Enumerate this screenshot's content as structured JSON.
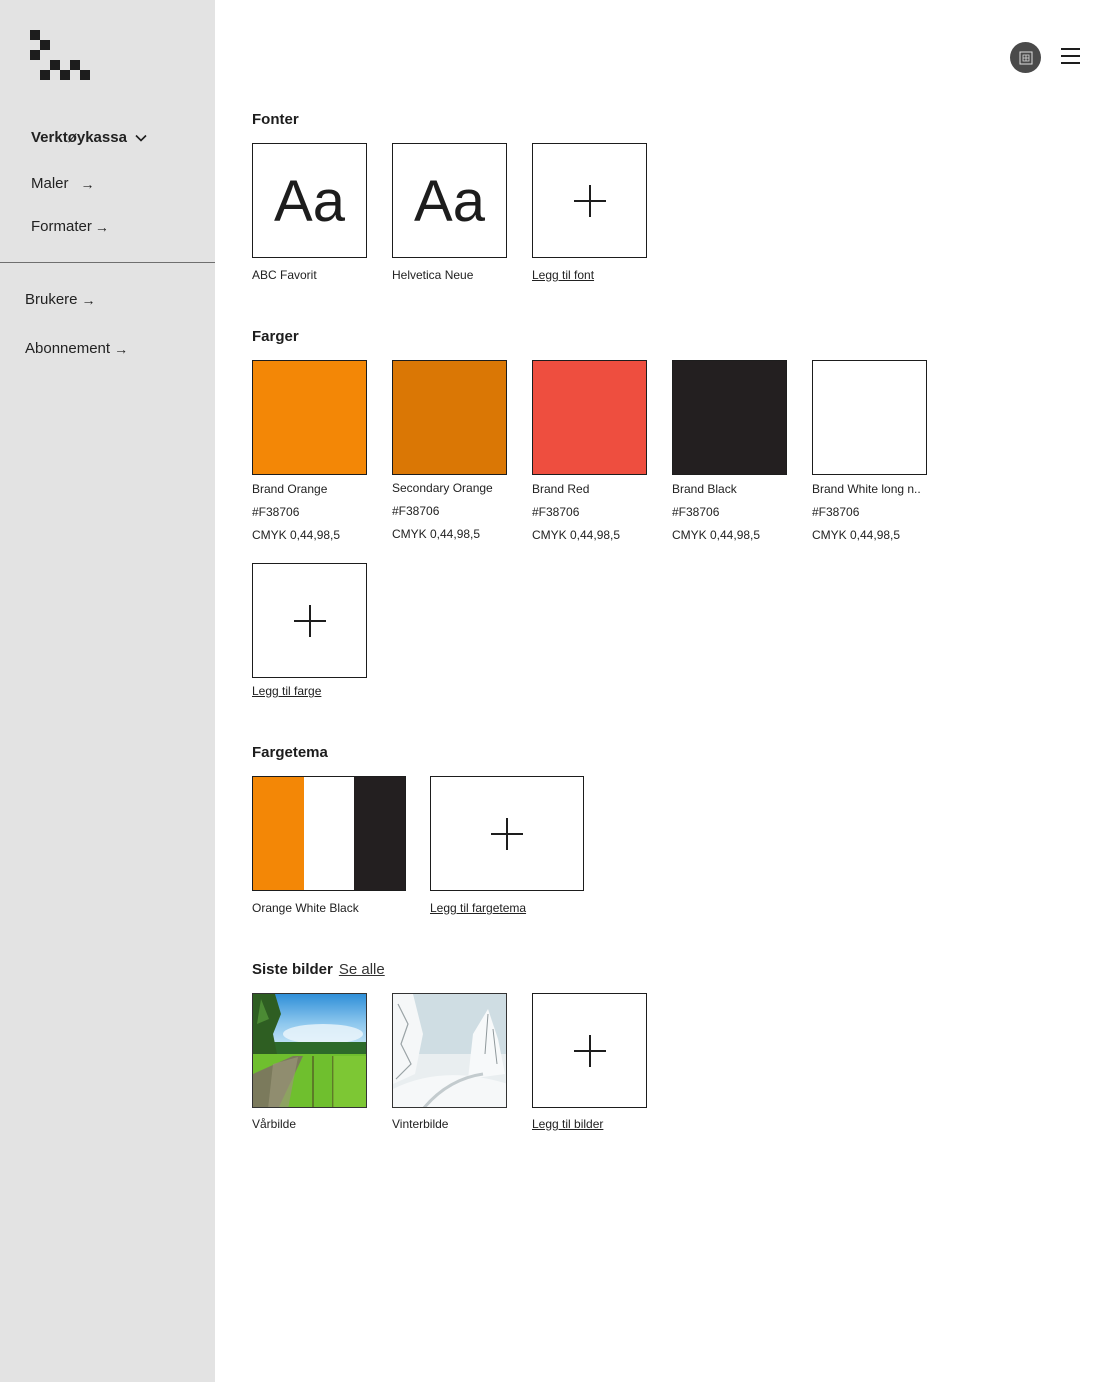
{
  "sidebar": {
    "main_label": "Verktøykassa",
    "maler": "Maler",
    "formater": "Formater",
    "brukere": "Brukere",
    "abonnement": "Abonnement",
    "arrow": "→"
  },
  "fonts": {
    "title": "Fonter",
    "sample": "Aa",
    "items": [
      {
        "name": "ABC Favorit"
      },
      {
        "name": "Helvetica Neue"
      }
    ],
    "add_label": "Legg til font"
  },
  "colors": {
    "title": "Farger",
    "items": [
      {
        "name": "Brand Orange",
        "hex": "#F38706",
        "cmyk": "CMYK 0,44,98,5",
        "swatch": "#F38706"
      },
      {
        "name": "Secondary Orange",
        "hex": "#F38706",
        "cmyk": "CMYK 0,44,98,5",
        "swatch": "#DA7705"
      },
      {
        "name": "Brand Red",
        "hex": "#F38706",
        "cmyk": "CMYK 0,44,98,5",
        "swatch": "#EE4E3F"
      },
      {
        "name": "Brand Black",
        "hex": "#F38706",
        "cmyk": "CMYK 0,44,98,5",
        "swatch": "#231F20"
      },
      {
        "name": "Brand White long n..",
        "hex": "#F38706",
        "cmyk": "CMYK 0,44,98,5",
        "swatch": "#FFFFFF"
      }
    ],
    "add_label": "Legg til farge"
  },
  "themes": {
    "title": "Fargetema",
    "items": [
      {
        "name": "Orange White Black",
        "colors": [
          "#F38706",
          "#FFFFFF",
          "#231F20"
        ]
      }
    ],
    "add_label": "Legg til fargetema"
  },
  "images": {
    "title": "Siste bilder",
    "see_all": "Se alle",
    "items": [
      {
        "name": "Vårbilde"
      },
      {
        "name": "Vinterbilde"
      }
    ],
    "add_label": "Legg til bilder"
  },
  "icons": {
    "logo": "checker-logo-icon",
    "user": "user-avatar-icon",
    "menu": "hamburger-menu-icon",
    "chevron": "chevron-down-icon",
    "arrow": "arrow-right-icon",
    "plus": "plus-icon"
  }
}
